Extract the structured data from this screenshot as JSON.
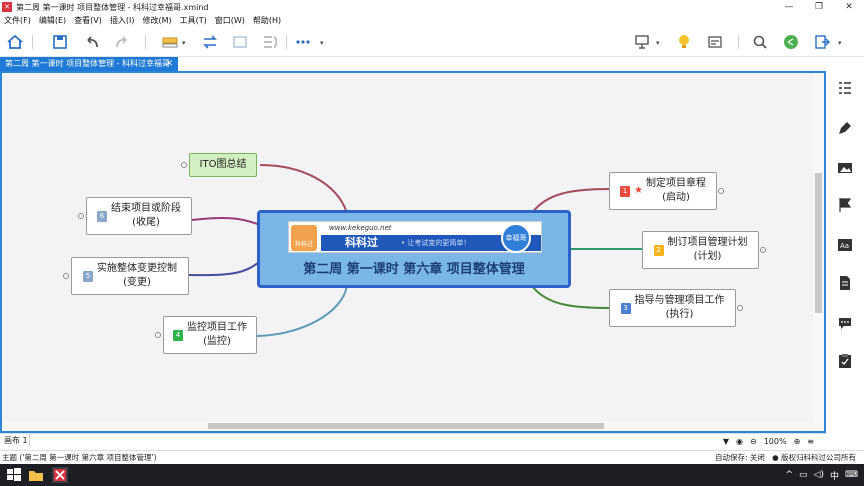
{
  "window": {
    "title": "第二周 第一课时 项目整体管理 - 科科过幸福哥.xmind",
    "minimize": "—",
    "maximize": "❐",
    "close": "✕"
  },
  "menu": [
    "文件(F)",
    "编辑(E)",
    "查看(V)",
    "插入(I)",
    "修改(M)",
    "工具(T)",
    "窗口(W)",
    "帮助(H)"
  ],
  "tab": {
    "label": "第二周 第一课时 项目整体管理 - 科科过幸福哥",
    "close": "✕"
  },
  "central": {
    "url": "www.kekeguo.net",
    "brand": "科科过",
    "slogan": "• 让考试变的更简单！",
    "logo_text": "科科过",
    "avatar_text": "幸福哥",
    "title": "第二周 第一课时  第六章 项目整体管理"
  },
  "nodes": {
    "ito": {
      "label": "ITO图总结"
    },
    "close_project": {
      "badge": "6",
      "line1": "结束项目或阶段",
      "line2": "(收尾)"
    },
    "change_control": {
      "badge": "5",
      "line1": "实施整体变更控制",
      "line2": "(变更)"
    },
    "monitor": {
      "badge": "4",
      "line1": "监控项目工作",
      "line2": "(监控)"
    },
    "charter": {
      "badge": "1",
      "line1": "制定项目章程",
      "line2": "(启动)"
    },
    "plan": {
      "badge": "2",
      "line1": "制订项目管理计划",
      "line2": "(计划)"
    },
    "execute": {
      "badge": "3",
      "line1": "指导与管理项目工作",
      "line2": "(执行)"
    }
  },
  "colors": {
    "accent": "#1e7ad6",
    "central_border": "#2d63c8",
    "ito_fill": "#d4f0c2",
    "badge1": "#e74c3c",
    "badge2": "#f5b41c",
    "badge3": "#4a7fd4",
    "badge4": "#2db34a",
    "badge5": "#8aa6c8",
    "badge6": "#8aa6c8"
  },
  "sheet": {
    "label": "画布 1"
  },
  "zoom": {
    "filter": "▼",
    "eye": "◉",
    "minus": "⊖",
    "level": "100%",
    "plus": "⊕",
    "menu": "≡"
  },
  "status": {
    "topic": "主题 ('第二周 第一课时  第六章 项目整体管理')",
    "autosave": "自动保存: 关闭",
    "copyright": "● 版权归科科过公司所有"
  },
  "tray": {
    "ime": "中",
    "up": "^"
  }
}
